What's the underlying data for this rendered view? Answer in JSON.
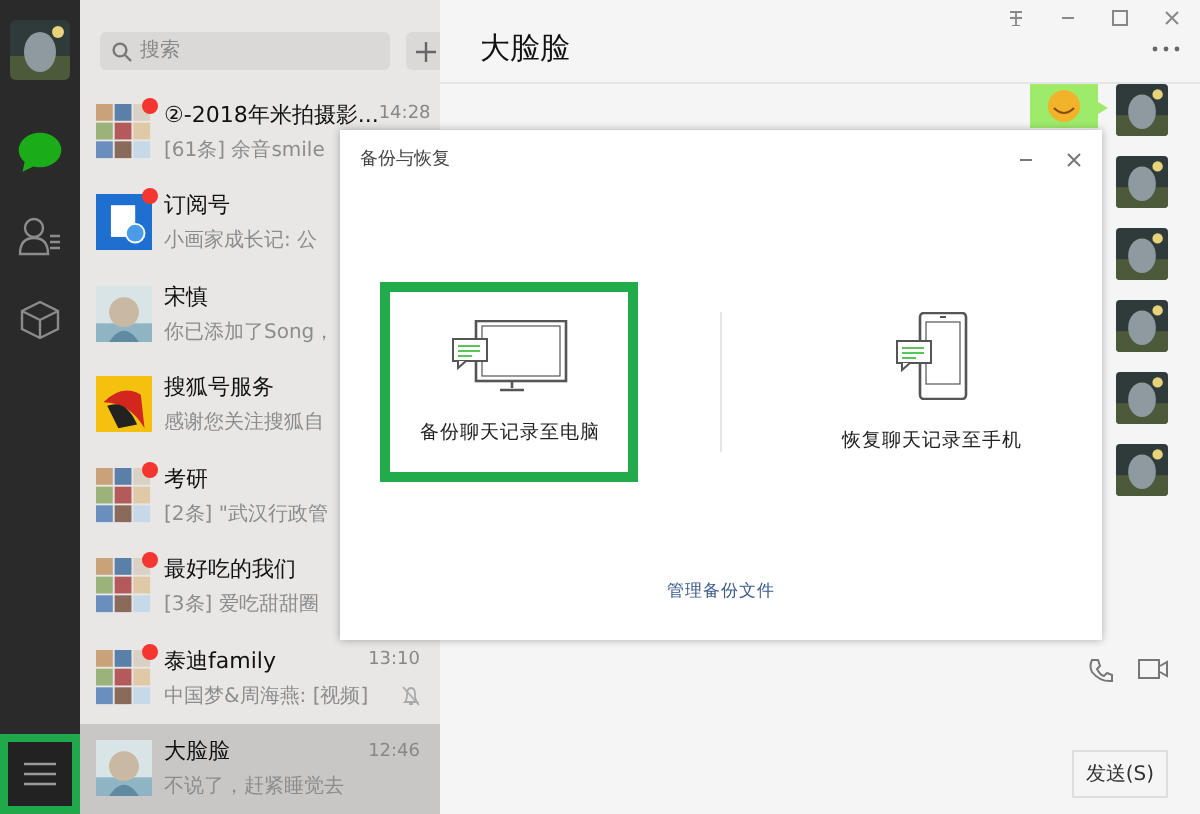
{
  "sidebar": {
    "nav": [
      {
        "kind": "chat",
        "selected": true
      },
      {
        "kind": "contacts",
        "selected": false
      },
      {
        "kind": "box",
        "selected": false
      }
    ],
    "menu_highlighted": true
  },
  "search": {
    "placeholder": "搜索"
  },
  "chats": [
    {
      "title": "②-2018年米拍摄影...",
      "preview": "[61条] 余音smile",
      "time": "14:28",
      "unread": true,
      "muted": false,
      "selected": false
    },
    {
      "title": "订阅号",
      "preview": "小画家成长记: 公",
      "unread": true,
      "muted": false,
      "selected": false
    },
    {
      "title": "宋慎",
      "preview": "你已添加了Song，",
      "unread": false,
      "muted": false,
      "selected": false
    },
    {
      "title": "搜狐号服务",
      "preview": "感谢您关注搜狐自",
      "unread": false,
      "muted": false,
      "selected": false
    },
    {
      "title": "考研",
      "preview": "[2条] \"武汉行政管",
      "unread": true,
      "muted": false,
      "selected": false
    },
    {
      "title": "最好吃的我们",
      "preview": "[3条] 爱吃甜甜圈",
      "unread": true,
      "muted": false,
      "selected": false
    },
    {
      "title": "泰迪family",
      "preview": "中国梦&周海燕: [视频]",
      "time": "13:10",
      "unread": true,
      "muted": true,
      "selected": false
    },
    {
      "title": "大脸脸",
      "preview": "不说了，赶紧睡觉去",
      "time": "12:46",
      "unread": false,
      "muted": false,
      "selected": true
    }
  ],
  "chat": {
    "title": "大脸脸",
    "send_button": "发送(S)"
  },
  "dialog": {
    "title": "备份与恢复",
    "options": [
      {
        "kind": "computer",
        "label": "备份聊天记录至电脑",
        "selected": true
      },
      {
        "kind": "phone",
        "label": "恢复聊天记录至手机",
        "selected": false
      }
    ],
    "link": "管理备份文件"
  }
}
